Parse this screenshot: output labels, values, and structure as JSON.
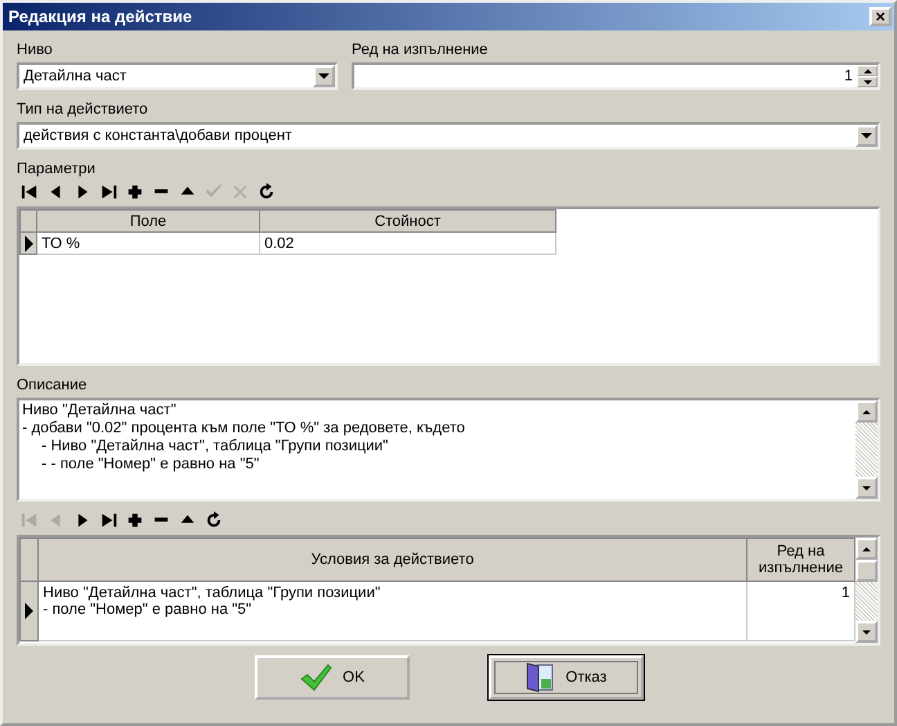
{
  "window": {
    "title": "Редакция на действие",
    "close": "×"
  },
  "level_field": {
    "label": "Ниво",
    "value": "Детайлна част"
  },
  "order_field": {
    "label": "Ред на изпълнение",
    "value": "1"
  },
  "type_field": {
    "label": "Тип на действието",
    "value": "действия с константа\\добави процент"
  },
  "parameters": {
    "label": "Параметри",
    "toolbar": [
      {
        "kind": "first",
        "disabled": false
      },
      {
        "kind": "prev",
        "disabled": false
      },
      {
        "kind": "next",
        "disabled": false
      },
      {
        "kind": "last",
        "disabled": false
      },
      {
        "kind": "add",
        "disabled": false
      },
      {
        "kind": "delete",
        "disabled": false
      },
      {
        "kind": "up",
        "disabled": false
      },
      {
        "kind": "post",
        "disabled": true
      },
      {
        "kind": "cancel",
        "disabled": true
      },
      {
        "kind": "refresh",
        "disabled": false
      }
    ],
    "columns": [
      "Поле",
      "Стойност"
    ],
    "rows": [
      {
        "selected": true,
        "cells": [
          "ТО %",
          "0.02"
        ]
      }
    ]
  },
  "description": {
    "label": "Описание",
    "lines": [
      {
        "text": "Ниво \"Детайлна част\"",
        "indent": false
      },
      {
        "text": "- добави \"0.02\" процента към поле \"ТО %\" за редовете, където",
        "indent": false
      },
      {
        "text": "- Ниво \"Детайлна част\", таблица \"Групи позиции\"",
        "indent": true
      },
      {
        "text": "- - поле \"Номер\" е равно на \"5\"",
        "indent": true
      }
    ]
  },
  "conditions": {
    "toolbar": [
      {
        "kind": "first",
        "disabled": true
      },
      {
        "kind": "prev",
        "disabled": true
      },
      {
        "kind": "next",
        "disabled": false
      },
      {
        "kind": "last",
        "disabled": false
      },
      {
        "kind": "add",
        "disabled": false
      },
      {
        "kind": "delete",
        "disabled": false
      },
      {
        "kind": "up",
        "disabled": false
      },
      {
        "kind": "refresh",
        "disabled": false
      }
    ],
    "columns": [
      "Условия за действието",
      "Ред на изпълнение"
    ],
    "rows": [
      {
        "selected": true,
        "lines": [
          "Ниво \"Детайлна част\", таблица \"Групи позиции\"",
          "- поле \"Номер\" е равно на \"5\""
        ],
        "order": "1"
      }
    ]
  },
  "buttons": [
    {
      "kind": "ok",
      "label": "OK",
      "focused": false
    },
    {
      "kind": "cancel",
      "label": "Отказ",
      "focused": true
    }
  ]
}
